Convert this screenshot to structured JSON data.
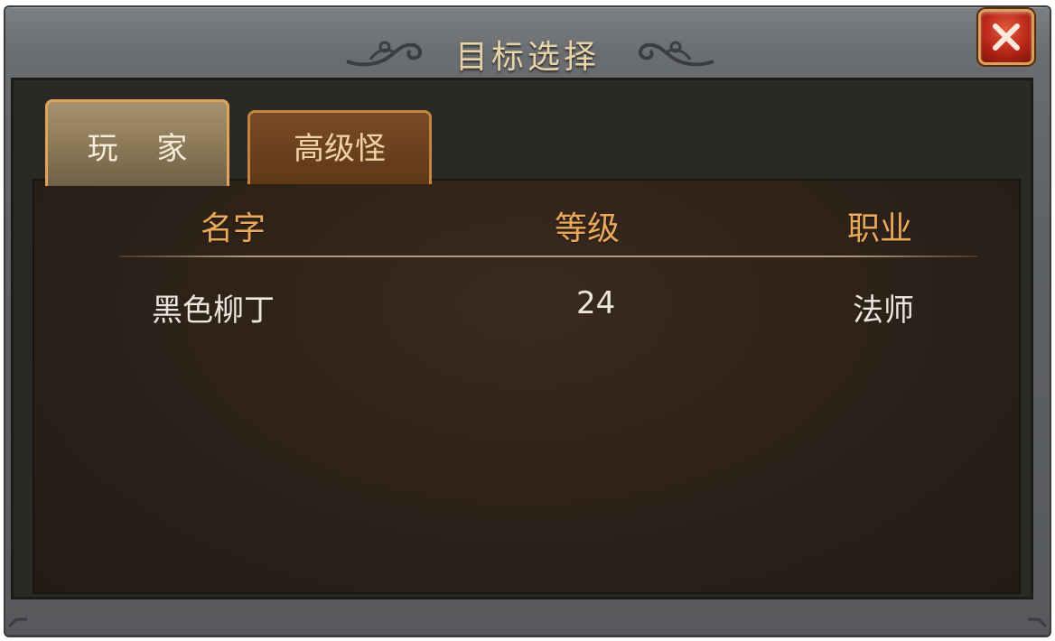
{
  "window": {
    "title": "目标选择",
    "close_icon": "close-icon"
  },
  "tabs": [
    {
      "label": "玩 家",
      "selected": true
    },
    {
      "label": "高级怪",
      "selected": false
    }
  ],
  "table": {
    "headers": {
      "name": "名字",
      "level": "等级",
      "class": "职业"
    },
    "rows": [
      {
        "name": "黑色柳丁",
        "level": "24",
        "class": "法师"
      }
    ]
  },
  "colors": {
    "frame": "#6a6d70",
    "header_text": "#e9a85a",
    "row_text": "#ece6dc",
    "close_red": "#b82718",
    "tab_border_gold": "#e0a55a"
  }
}
